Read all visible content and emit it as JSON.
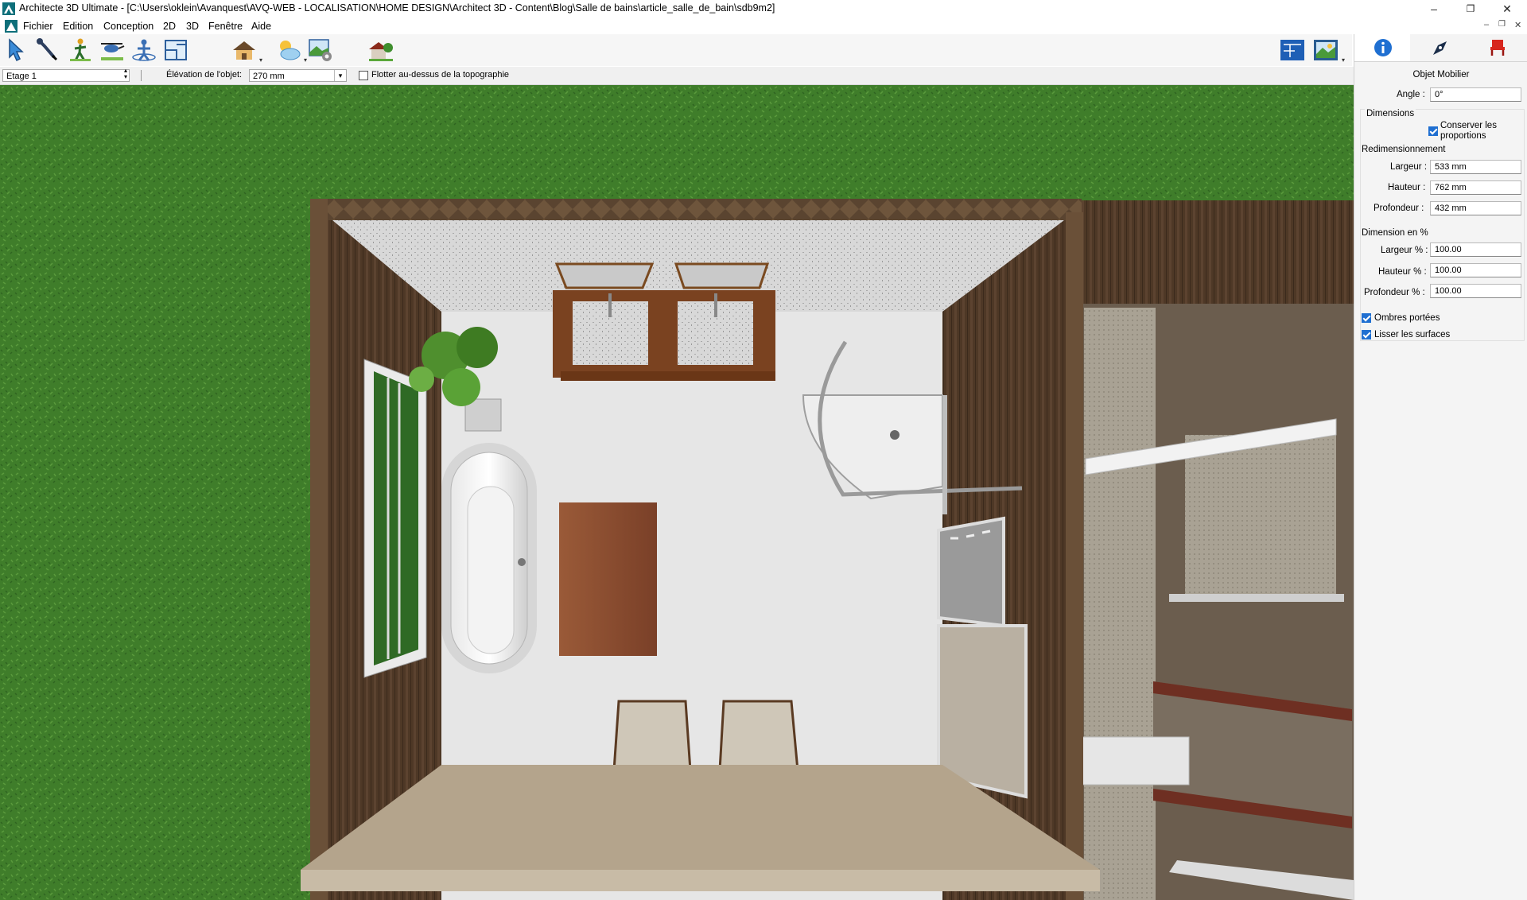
{
  "window": {
    "title": "Architecte 3D Ultimate - [C:\\Users\\oklein\\Avanquest\\AVQ-WEB - LOCALISATION\\HOME DESIGN\\Architect 3D - Content\\Blog\\Salle de bains\\article_salle_de_bain\\sdb9m2]",
    "minimize": "–",
    "maximize": "❐",
    "close": "✕",
    "doc_minimize": "–",
    "doc_restore": "❐",
    "doc_close": "✕"
  },
  "menu": [
    "Fichier",
    "Edition",
    "Conception",
    "2D",
    "3D",
    "Fenêtre",
    "Aide"
  ],
  "options_bar": {
    "floor_value": "Etage 1",
    "elevation_label": "Élévation de l'objet:",
    "elevation_value": "270 mm",
    "float_label": "Flotter au-dessus de la topographie",
    "float_checked": false
  },
  "panel": {
    "object_type": "Objet Mobilier",
    "angle_label": "Angle :",
    "angle_value": "0°",
    "dimensions_header": "Dimensions",
    "keep_proportions": "Conserver les proportions",
    "resize_header": "Redimensionnement",
    "width_label": "Largeur :",
    "width_value": "533 mm",
    "height_label": "Hauteur :",
    "height_value": "762 mm",
    "depth_label": "Profondeur :",
    "depth_value": "432 mm",
    "percent_header": "Dimension en %",
    "width_pct_label": "Largeur % :",
    "width_pct_value": "100.00",
    "height_pct_label": "Hauteur % :",
    "height_pct_value": "100.00",
    "depth_pct_label": "Profondeur % :",
    "depth_pct_value": "100.00",
    "shadows_label": "Ombres portées",
    "smooth_label": "Lisser les surfaces"
  },
  "colors": {
    "grass": "#3f7d2a",
    "accent_blue": "#1f6fd1",
    "wall_wood": "#4a3525",
    "floor": "#e6e6e6"
  }
}
